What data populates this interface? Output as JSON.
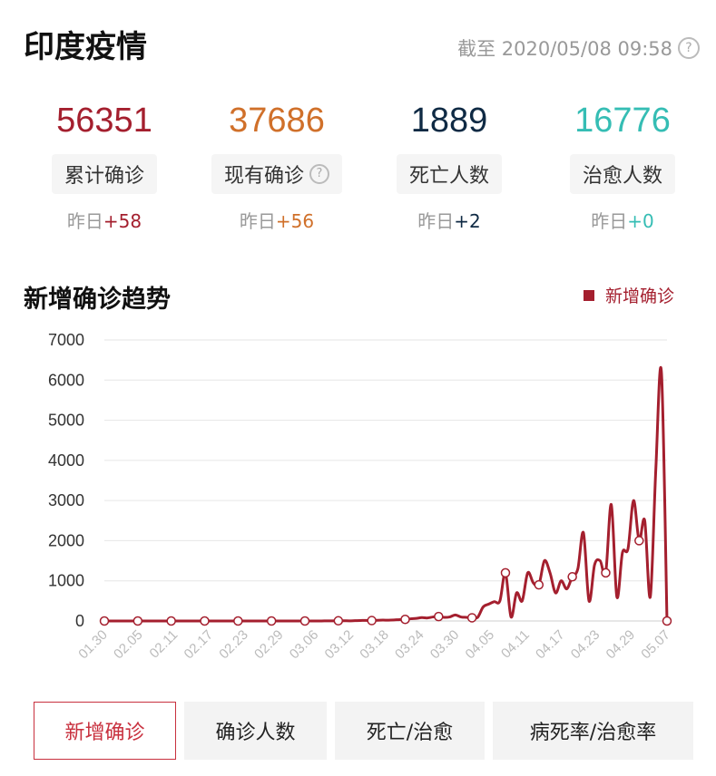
{
  "header": {
    "title": "印度疫情",
    "timestamp": "截至 2020/05/08 09:58"
  },
  "stats": [
    {
      "value": "56351",
      "label": "累计确诊",
      "delta_prefix": "昨日",
      "delta": "+58",
      "color": "#a41f2e",
      "has_help": false
    },
    {
      "value": "37686",
      "label": "现有确诊",
      "delta_prefix": "昨日",
      "delta": "+56",
      "color": "#d0702a",
      "has_help": true
    },
    {
      "value": "1889",
      "label": "死亡人数",
      "delta_prefix": "昨日",
      "delta": "+2",
      "color": "#0f2a44",
      "has_help": false
    },
    {
      "value": "16776",
      "label": "治愈人数",
      "delta_prefix": "昨日",
      "delta": "+0",
      "color": "#35bdb4",
      "has_help": false
    }
  ],
  "chart_title": "新增确诊趋势",
  "chart_data": {
    "type": "line",
    "ylim": [
      0,
      7000
    ],
    "yticks": [
      0,
      1000,
      2000,
      3000,
      4000,
      5000,
      6000,
      7000
    ],
    "xticks": [
      "01.30",
      "02.05",
      "02.11",
      "02.17",
      "02.23",
      "02.29",
      "03.06",
      "03.12",
      "03.18",
      "03.24",
      "03.30",
      "04.05",
      "04.11",
      "04.17",
      "04.23",
      "04.29",
      "05.07"
    ],
    "grid": true,
    "legend_position": "top-right",
    "series": [
      {
        "name": "新增确诊",
        "color": "#a41f2e",
        "values": [
          0,
          0,
          0,
          0,
          0,
          0,
          0,
          0,
          0,
          0,
          0,
          0,
          0,
          0,
          0,
          0,
          0,
          0,
          0,
          0,
          0,
          0,
          0,
          0,
          0,
          0,
          0,
          0,
          0,
          0,
          0,
          0,
          0,
          0,
          0,
          0,
          0,
          0,
          0,
          0,
          3,
          2,
          5,
          6,
          4,
          8,
          12,
          15,
          10,
          18,
          22,
          20,
          25,
          35,
          40,
          55,
          65,
          85,
          75,
          100,
          110,
          90,
          100,
          150,
          100,
          90,
          80,
          90,
          350,
          420,
          480,
          500,
          1200,
          100,
          700,
          500,
          1200,
          950,
          900,
          1500,
          1200,
          700,
          1000,
          800,
          1100,
          1300,
          2200,
          500,
          1400,
          1500,
          1200,
          2900,
          600,
          1700,
          1800,
          3000,
          2000,
          2500,
          600,
          3800,
          6200,
          0
        ]
      }
    ],
    "markers_every": 6
  },
  "tabs": [
    {
      "label": "新增确诊",
      "active": true
    },
    {
      "label": "确诊人数",
      "active": false
    },
    {
      "label": "死亡/治愈",
      "active": false
    },
    {
      "label": "病死率/治愈率",
      "active": false
    }
  ]
}
